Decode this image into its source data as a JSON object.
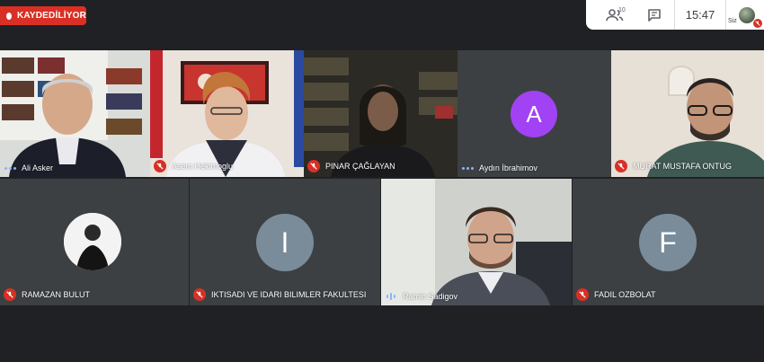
{
  "recording": {
    "label": "KAYDEDİLİYOR"
  },
  "topbar": {
    "participant_count": "10",
    "time": "15:47",
    "self_label": "Siz"
  },
  "participants": [
    {
      "name": "Ali Asker",
      "status": "speaking-dots"
    },
    {
      "name": "Asem Hekimoglu",
      "status": "muted"
    },
    {
      "name": "PINAR ÇAĞLAYAN",
      "status": "muted"
    },
    {
      "name": "Aydın İbrahimov",
      "status": "speaking-dots",
      "avatar_letter": "A",
      "avatar_color": "#a142f4"
    },
    {
      "name": "MURAT MUSTAFA ONTUG",
      "status": "muted"
    },
    {
      "name": "RAMAZAN BULUT",
      "status": "muted"
    },
    {
      "name": "IKTISADI VE IDARI BILIMLER FAKULTESI",
      "status": "muted",
      "avatar_letter": "I",
      "avatar_color": "#7a8c99"
    },
    {
      "name": "Ramin Sadigov",
      "status": "speaking-bars"
    },
    {
      "name": "FADIL OZBOLAT",
      "status": "muted",
      "avatar_letter": "F",
      "avatar_color": "#7a8c99"
    }
  ],
  "colors": {
    "background": "#202124",
    "tile": "#3c4043",
    "mute": "#d93025",
    "recording": "#d93025"
  }
}
